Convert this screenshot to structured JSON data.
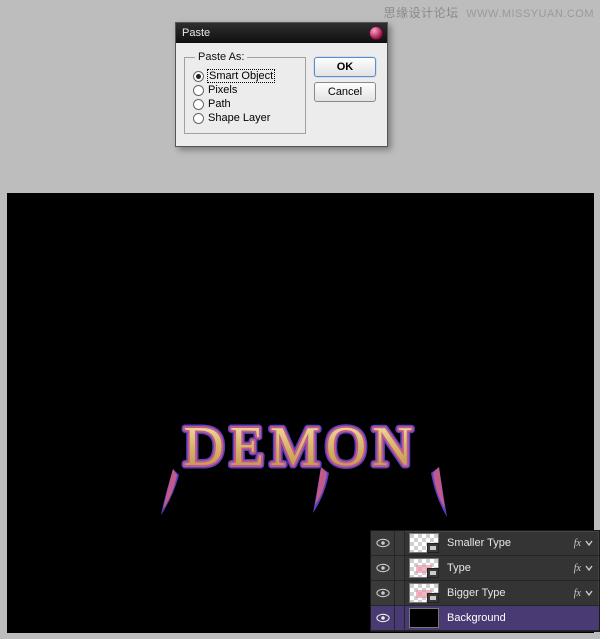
{
  "watermark": {
    "cn": "思缘设计论坛",
    "en": "WWW.MISSYUAN.COM"
  },
  "dialog": {
    "title": "Paste",
    "legend": "Paste As:",
    "options": {
      "smart_object": "Smart Object",
      "pixels": "Pixels",
      "path": "Path",
      "shape_layer": "Shape Layer"
    },
    "selected": "smart_object",
    "ok": "OK",
    "cancel": "Cancel"
  },
  "canvas": {
    "text": "DEMON"
  },
  "layers": {
    "items": [
      {
        "name": "Smaller Type",
        "thumb": "transparent",
        "has_fx": true
      },
      {
        "name": "Type",
        "thumb": "pink",
        "has_fx": true
      },
      {
        "name": "Bigger Type",
        "thumb": "pink",
        "has_fx": true
      },
      {
        "name": "Background",
        "thumb": "black",
        "has_fx": false
      }
    ],
    "fx_label": "fx",
    "selected_index": 3
  }
}
